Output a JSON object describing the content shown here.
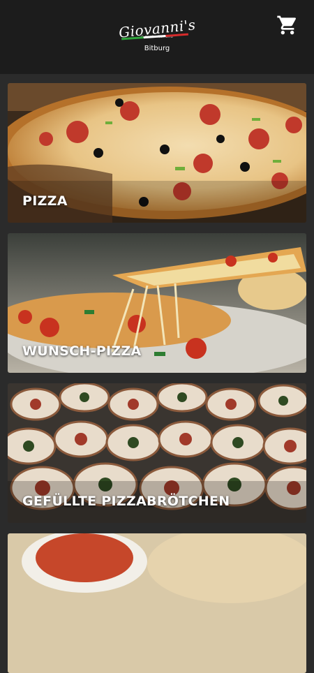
{
  "header": {
    "logo_text": "Giovanni's",
    "logo_tagline": "il gusto italiano",
    "city": "Bitburg",
    "cart_icon": "cart-icon"
  },
  "categories": [
    {
      "label": "PIZZA"
    },
    {
      "label": "WUNSCH-PIZZA"
    },
    {
      "label": "GEFÜLLTE PIZZABRÖTCHEN"
    },
    {
      "label": ""
    }
  ]
}
